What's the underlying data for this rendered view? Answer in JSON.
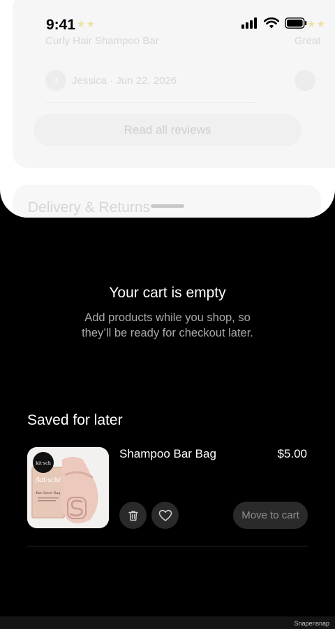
{
  "status_bar": {
    "time": "9:41"
  },
  "background_page": {
    "review_stars": "★★",
    "review_title": "Curly Hair Shampoo Bar",
    "review_meta": "Jessica · Jun 22, 2026",
    "review_avatar_initial": "J",
    "next_review_title": "Great",
    "read_all_label": "Read all reviews",
    "delivery_heading": "Delivery & Returns"
  },
  "empty_cart": {
    "title": "Your cart is empty",
    "subtitle": "Add products while you shop, so they’ll be ready for checkout later."
  },
  "saved_for_later": {
    "heading": "Saved for later",
    "item": {
      "name": "Shampoo Bar Bag",
      "price": "$5.00",
      "move_label": "Move to cart",
      "brand_badge": "kit·sch",
      "package_brand": "/kit·sch/",
      "package_label": "Bar Saver Bag"
    }
  },
  "watermark": "Snapensnap"
}
